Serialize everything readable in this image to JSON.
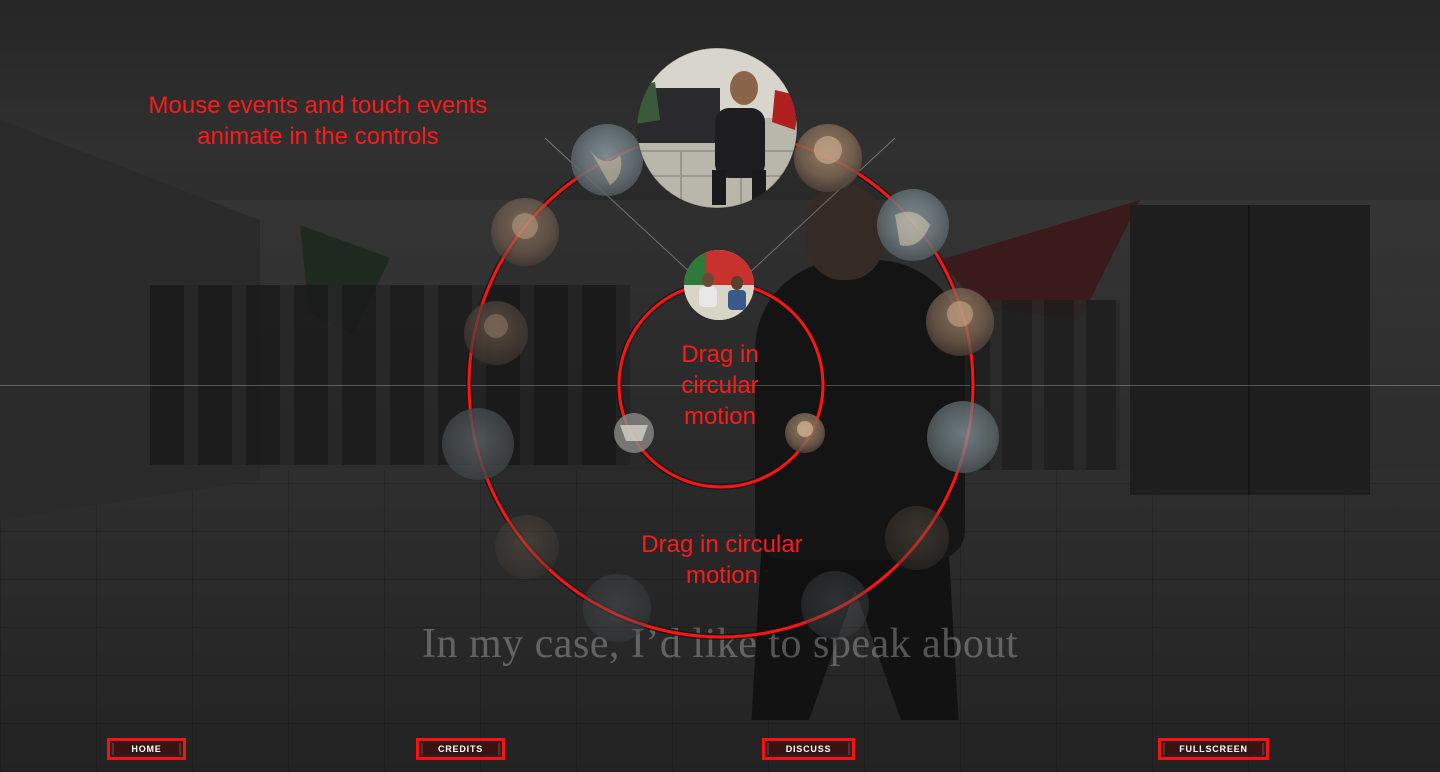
{
  "annotation": {
    "line1": "Mouse events and touch events",
    "line2": "animate in the controls"
  },
  "outer_wheel": {
    "label_line1": "Drag in circular",
    "label_line2": "motion"
  },
  "inner_wheel": {
    "label_line1": "Drag in",
    "label_line2": "circular",
    "label_line3": "motion"
  },
  "subtitle": "In my case, I’d like to speak about",
  "nav": {
    "home": "HOME",
    "credits": "CREDITS",
    "discuss": "DISCUSS",
    "fullscreen": "FULLSCREEN"
  },
  "colors": {
    "annotation_red": "#ff1a1a",
    "nav_bg": "#3a1212"
  }
}
